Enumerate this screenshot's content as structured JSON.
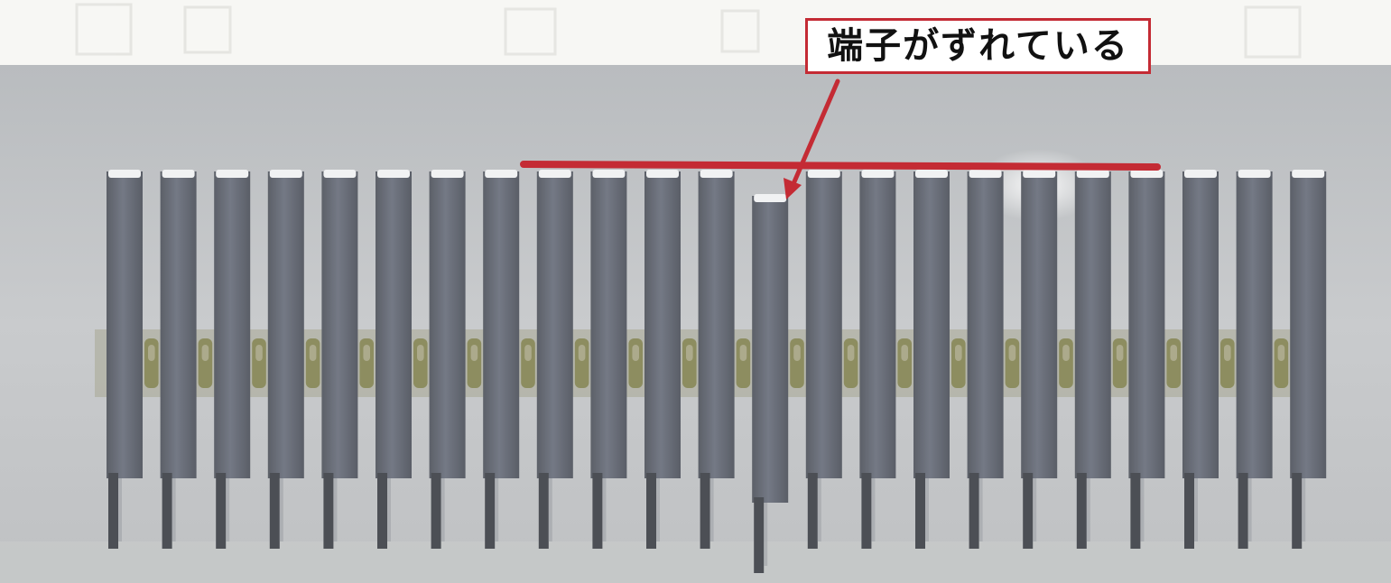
{
  "callout": {
    "label": "端子がずれている"
  },
  "colors": {
    "annotation_red": "#c42b34",
    "board": "#c4c6c8",
    "pin": "#6c717b",
    "solder": "#8f8f52"
  },
  "scene": {
    "pin_count": 23,
    "misaligned_pin_index": 12
  }
}
